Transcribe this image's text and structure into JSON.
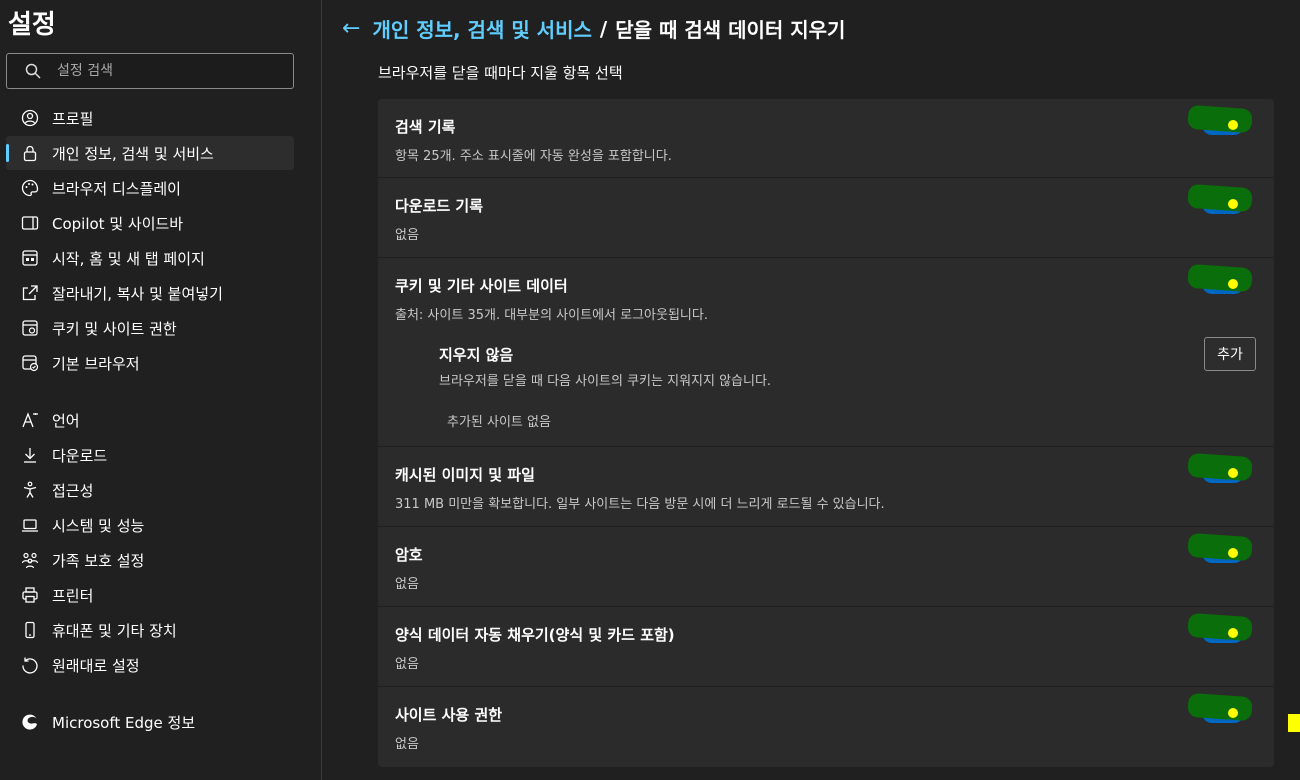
{
  "sidebar": {
    "title": "설정",
    "search_placeholder": "설정 검색",
    "items": [
      {
        "label": "프로필",
        "icon": "profile-icon"
      },
      {
        "label": "개인 정보, 검색 및 서비스",
        "icon": "lock-icon",
        "active": true
      },
      {
        "label": "브라우저 디스플레이",
        "icon": "palette-icon"
      },
      {
        "label": "Copilot 및 사이드바",
        "icon": "sidebar-icon"
      },
      {
        "label": "시작, 홈 및 새 탭 페이지",
        "icon": "home-tab-icon"
      },
      {
        "label": "잘라내기, 복사 및 붙여넣기",
        "icon": "share-icon"
      },
      {
        "label": "쿠키 및 사이트 권한",
        "icon": "cookie-icon"
      },
      {
        "label": "기본 브라우저",
        "icon": "browser-icon"
      },
      {
        "label": "언어",
        "icon": "language-icon"
      },
      {
        "label": "다운로드",
        "icon": "download-icon"
      },
      {
        "label": "접근성",
        "icon": "accessibility-icon"
      },
      {
        "label": "시스템 및 성능",
        "icon": "laptop-icon"
      },
      {
        "label": "가족 보호 설정",
        "icon": "family-icon"
      },
      {
        "label": "프린터",
        "icon": "printer-icon"
      },
      {
        "label": "휴대폰 및 기타 장치",
        "icon": "phone-icon"
      },
      {
        "label": "원래대로 설정",
        "icon": "reset-icon"
      },
      {
        "label": "Microsoft Edge 정보",
        "icon": "edge-logo-icon"
      }
    ]
  },
  "header": {
    "back_icon": "←",
    "crumb": "개인 정보, 검색 및 서비스",
    "separator": "/",
    "title": "닫을 때 검색 데이터 지우기"
  },
  "subtitle": "브라우저를 닫을 때마다 지울 항목 선택",
  "rows": [
    {
      "title": "검색 기록",
      "desc": "항목 25개. 주소 표시줄에 자동 완성을 포함합니다.",
      "on": true
    },
    {
      "title": "다운로드 기록",
      "desc": "없음",
      "on": true
    },
    {
      "title": "쿠키 및 기타 사이트 데이터",
      "desc": "출처: 사이트 35개. 대부분의 사이트에서 로그아웃됩니다.",
      "on": true
    },
    {
      "title": "캐시된 이미지 및 파일",
      "desc": "311 MB 미만을 확보합니다. 일부 사이트는 다음 방문 시에 더 느리게 로드될 수 있습니다.",
      "on": true
    },
    {
      "title": "암호",
      "desc": "없음",
      "on": true
    },
    {
      "title": "양식 데이터 자동 채우기(양식 및 카드 포함)",
      "desc": "없음",
      "on": true
    },
    {
      "title": "사이트 사용 권한",
      "desc": "없음",
      "on": true
    }
  ],
  "cookies_sub": {
    "title": "지우지 않음",
    "desc": "브라우저를 닫을 때 다음 사이트의 쿠키는 지워지지 않습니다.",
    "add_label": "추가",
    "empty": "추가된 사이트 없음"
  },
  "colors": {
    "accent": "#60cdff",
    "toggle_on": "#0067c0",
    "highlight": "#0a6e0a",
    "knob": "#ffff00"
  }
}
